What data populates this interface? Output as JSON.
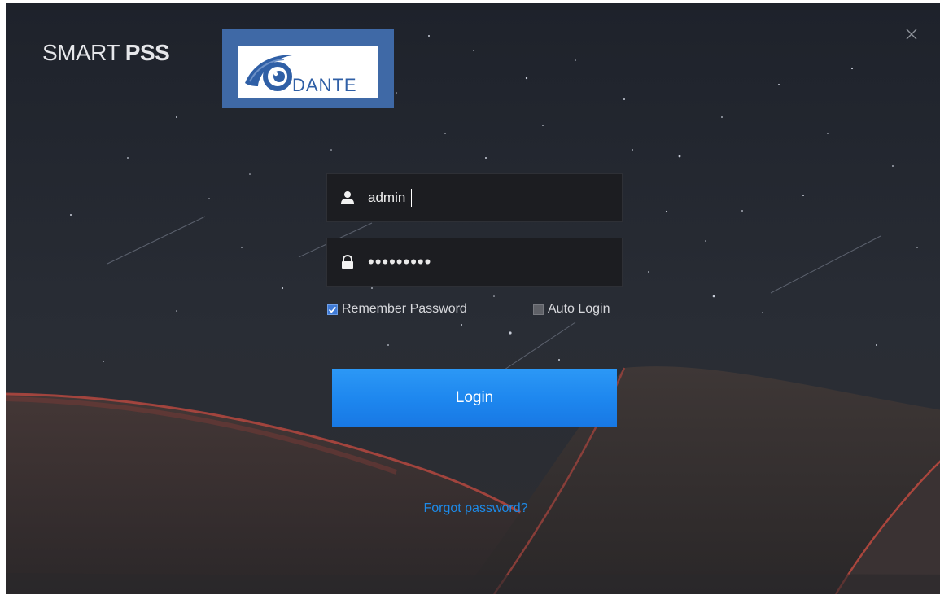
{
  "app": {
    "title_light": "SMART ",
    "title_bold": "PSS"
  },
  "logo": {
    "text": "DANTE",
    "box_color": "#3f69a6"
  },
  "login_form": {
    "username_value": "admin",
    "password_value": "•••••••••",
    "remember_password_label": "Remember Password",
    "remember_password_checked": true,
    "auto_login_label": "Auto Login",
    "auto_login_checked": false,
    "login_button_label": "Login",
    "forgot_password_label": "Forgot password?"
  },
  "icons": {
    "close": "close-icon",
    "user": "user-icon",
    "lock": "lock-icon",
    "check": "check-icon"
  },
  "colors": {
    "accent": "#1d86ee",
    "link": "#1d8ae8",
    "field_bg": "#1c1d21"
  }
}
